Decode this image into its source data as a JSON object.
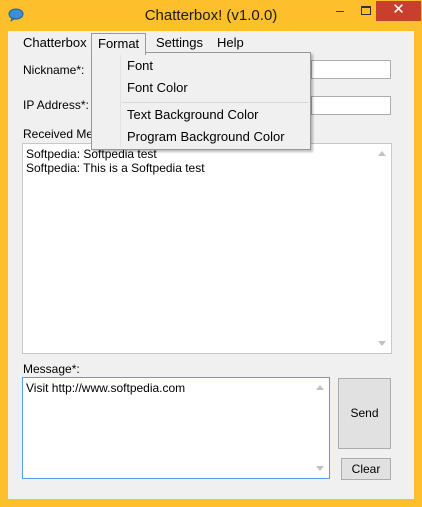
{
  "window": {
    "title": "Chatterbox! (v1.0.0)",
    "minimize_glyph": "–",
    "close_glyph": "✕"
  },
  "menu": {
    "items": [
      "Chatterbox",
      "Format",
      "Settings",
      "Help"
    ],
    "active": "Format"
  },
  "format_menu": {
    "items": [
      "Font",
      "Font Color",
      "Text Background Color",
      "Program Background Color"
    ]
  },
  "form": {
    "nickname_label": "Nickname*:",
    "nickname_value": "",
    "ip_label": "IP Address*:",
    "ip_value": "",
    "received_label": "Received Mes",
    "received_lines": "Softpedia: Softpedia test\nSoftpedia: This is a Softpedia test",
    "message_label": "Message*:",
    "message_value": "Visit http://www.softpedia.com"
  },
  "buttons": {
    "send": "Send",
    "clear": "Clear"
  },
  "colors": {
    "frame": "#fdc02c",
    "close": "#c7402b",
    "focus_border": "#569de5"
  }
}
